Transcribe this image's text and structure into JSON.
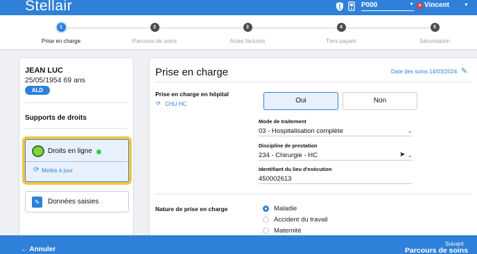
{
  "app": {
    "title": "Stellair"
  },
  "header": {
    "user_code": "P000",
    "user_name": "Vincent"
  },
  "stepper": {
    "steps": [
      {
        "num": "1",
        "label": "Prise en charge",
        "active": true
      },
      {
        "num": "2",
        "label": "Parcours de soins",
        "active": false
      },
      {
        "num": "3",
        "label": "Actes facturés",
        "active": false
      },
      {
        "num": "4",
        "label": "Tiers payant",
        "active": false
      },
      {
        "num": "5",
        "label": "Sécurisation",
        "active": false
      }
    ]
  },
  "patient": {
    "name": "JEAN LUC",
    "dob_age": "25/05/1954 69 ans",
    "badge": "ALD"
  },
  "supports": {
    "title": "Supports de droits",
    "online_label": "Droits en ligne",
    "online_status_color": "#2bd24a",
    "update_label": "Mettre à jour",
    "saisies_label": "Données saisies"
  },
  "main": {
    "title": "Prise en charge",
    "date_label": "Date des soins 14/03/2024",
    "hospital_label": "Prise en charge en hôpital",
    "hospital_link": "CHU HC",
    "yes_label": "Oui",
    "no_label": "Non",
    "treatment_label": "Mode de traitement",
    "treatment_value": "03 - Hospitalisation complète",
    "discipline_label": "Discipline de prestation",
    "discipline_value": "234 - Chirurgie - HC",
    "place_label": "Identifiant du lieu d'exécution",
    "place_value": "450002613",
    "nature_label": "Nature de prise en charge",
    "nature_options": [
      "Maladie",
      "Accident du travail",
      "Maternité"
    ],
    "nature_selected": "Maladie"
  },
  "footer": {
    "back_label": "← Annuler",
    "next_small": "Suivant",
    "next_label": "Parcours de soins →"
  },
  "colors": {
    "brand": "#2f80d8",
    "highlight": "#f4c542"
  }
}
